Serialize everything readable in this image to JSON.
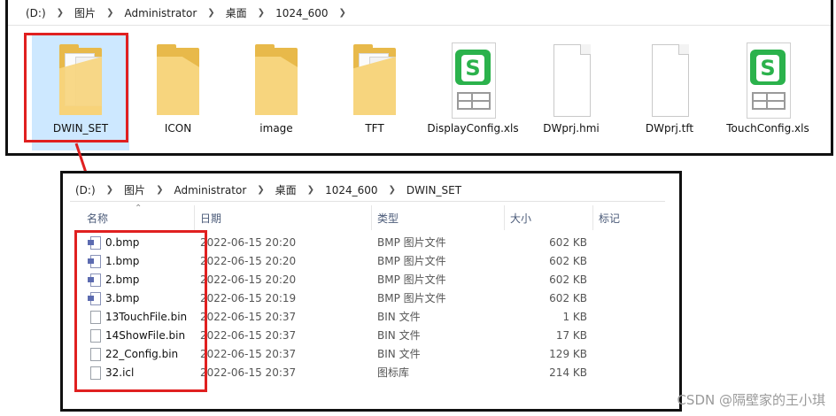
{
  "top_window": {
    "breadcrumb": [
      "(D:)",
      "图片",
      "Administrator",
      "桌面",
      "1024_600"
    ],
    "items": [
      {
        "label": "DWIN_SET",
        "kind": "folder-open",
        "selected": true
      },
      {
        "label": "ICON",
        "kind": "folder"
      },
      {
        "label": "image",
        "kind": "folder"
      },
      {
        "label": "TFT",
        "kind": "folder-open"
      },
      {
        "label": "DisplayConfig.xls",
        "kind": "xls"
      },
      {
        "label": "DWprj.hmi",
        "kind": "doc"
      },
      {
        "label": "DWprj.tft",
        "kind": "doc"
      },
      {
        "label": "TouchConfig.xls",
        "kind": "xls"
      }
    ]
  },
  "detail_window": {
    "breadcrumb": [
      "(D:)",
      "图片",
      "Administrator",
      "桌面",
      "1024_600",
      "DWIN_SET"
    ],
    "columns": {
      "name": "名称",
      "date": "日期",
      "type": "类型",
      "size": "大小",
      "tags": "标记"
    },
    "files": [
      {
        "name": "0.bmp",
        "date": "2022-06-15 20:20",
        "type": "BMP 图片文件",
        "size": "602 KB",
        "icon": "bmp"
      },
      {
        "name": "1.bmp",
        "date": "2022-06-15 20:20",
        "type": "BMP 图片文件",
        "size": "602 KB",
        "icon": "bmp"
      },
      {
        "name": "2.bmp",
        "date": "2022-06-15 20:20",
        "type": "BMP 图片文件",
        "size": "602 KB",
        "icon": "bmp"
      },
      {
        "name": "3.bmp",
        "date": "2022-06-15 20:19",
        "type": "BMP 图片文件",
        "size": "602 KB",
        "icon": "bmp"
      },
      {
        "name": "13TouchFile.bin",
        "date": "2022-06-15 20:37",
        "type": "BIN 文件",
        "size": "1 KB",
        "icon": "file"
      },
      {
        "name": "14ShowFile.bin",
        "date": "2022-06-15 20:37",
        "type": "BIN 文件",
        "size": "17 KB",
        "icon": "file"
      },
      {
        "name": "22_Config.bin",
        "date": "2022-06-15 20:37",
        "type": "BIN 文件",
        "size": "129 KB",
        "icon": "file"
      },
      {
        "name": "32.icl",
        "date": "2022-06-15 20:37",
        "type": "图标库",
        "size": "214 KB",
        "icon": "file"
      }
    ]
  },
  "watermark": "CSDN @隔壁家的王小琪",
  "colors": {
    "highlight": "#e02020",
    "selection": "#cde8ff",
    "folder": "#f7d57e",
    "xls_green": "#2bb24c"
  }
}
